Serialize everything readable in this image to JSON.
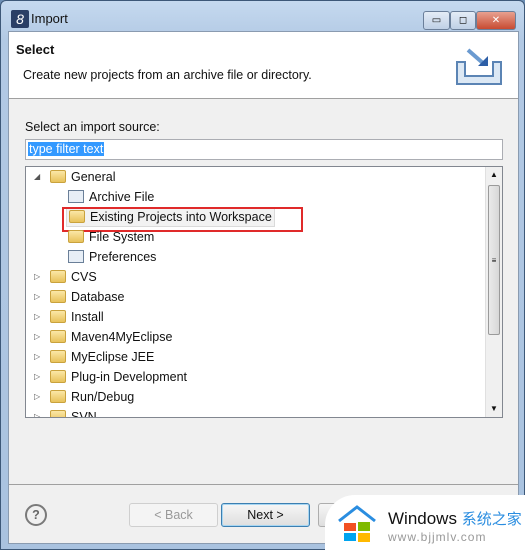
{
  "window": {
    "title": "Import",
    "minimize": "▭",
    "maximize": "◻",
    "close": "✕"
  },
  "header": {
    "title": "Select",
    "description": "Create new projects from an archive file or directory."
  },
  "source_label": "Select an import source:",
  "filter": {
    "value": "type filter text"
  },
  "tree": [
    {
      "label": "General",
      "expanded": true,
      "icon": "folder-open-icon",
      "children": [
        {
          "label": "Archive File",
          "icon": "archive-icon"
        },
        {
          "label": "Existing Projects into Workspace",
          "icon": "projects-folder-icon",
          "selected": true
        },
        {
          "label": "File System",
          "icon": "folder-icon"
        },
        {
          "label": "Preferences",
          "icon": "preferences-icon"
        }
      ]
    },
    {
      "label": "CVS"
    },
    {
      "label": "Database"
    },
    {
      "label": "Install"
    },
    {
      "label": "Maven4MyEclipse"
    },
    {
      "label": "MyEclipse JEE"
    },
    {
      "label": "Plug-in Development"
    },
    {
      "label": "Run/Debug"
    },
    {
      "label": "SVN"
    }
  ],
  "buttons": {
    "help": "?",
    "back": "< Back",
    "next": "Next >"
  },
  "highlight_color": "#e02a2a",
  "watermark": {
    "brand": "Windows",
    "cn": "系统之家",
    "url": "www.bjjmlv.com"
  }
}
